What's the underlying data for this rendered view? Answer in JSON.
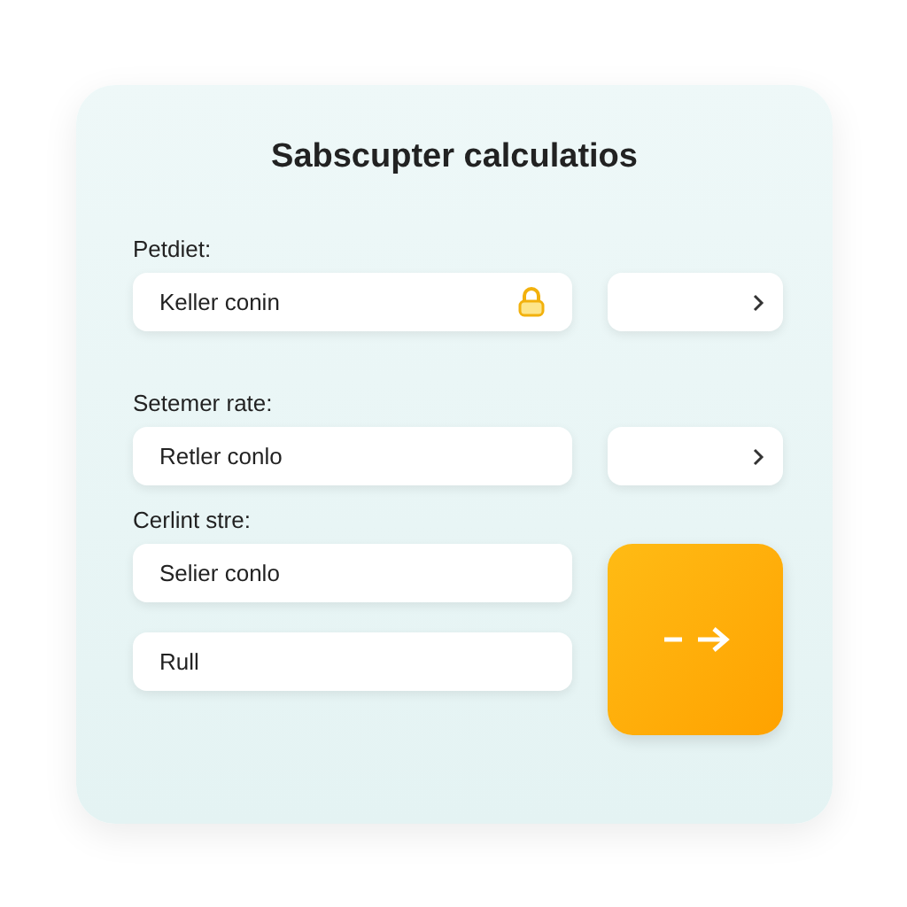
{
  "title": "Sabscupter calculatios",
  "sections": [
    {
      "label": "Petdiet:",
      "fields": [
        {
          "value": "Keller conin",
          "kind": "locked"
        }
      ],
      "side_button": {
        "kind": "chevron"
      }
    },
    {
      "label": "Setemer rate:",
      "fields": [
        {
          "value": "Retler conlo",
          "kind": "plain"
        }
      ],
      "side_button": {
        "kind": "chevron"
      }
    },
    {
      "label": "Cerlint stre:",
      "fields": [
        {
          "value": "Selier conlo",
          "kind": "plain"
        },
        {
          "value": "Rull",
          "kind": "plain"
        }
      ],
      "side_button": {
        "kind": "go"
      }
    }
  ]
}
